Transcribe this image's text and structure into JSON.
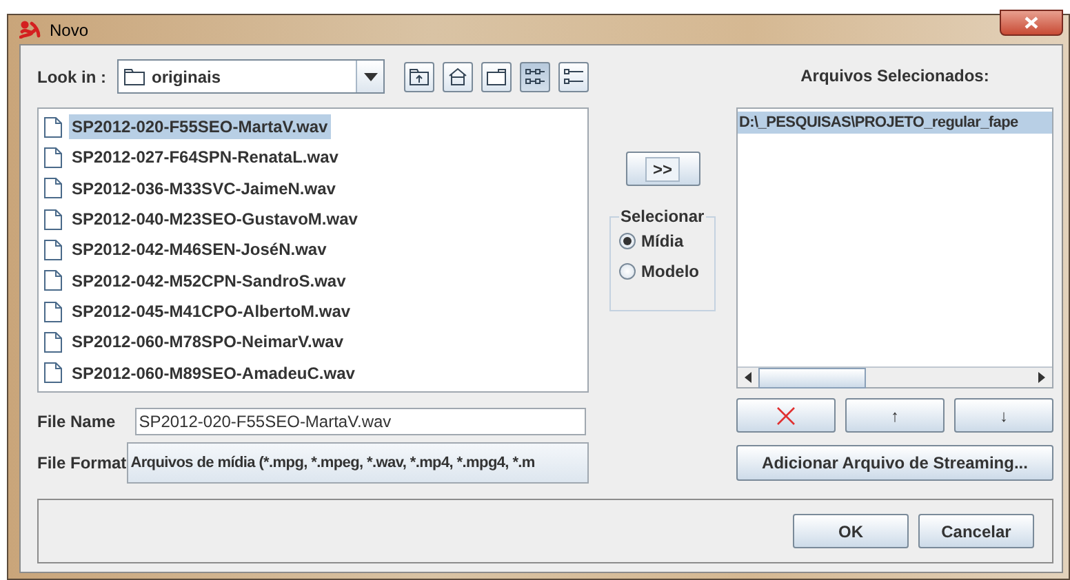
{
  "window": {
    "title": "Novo"
  },
  "look_in": {
    "label": "Look in :",
    "value": "originais"
  },
  "view_buttons": [
    {
      "kind": "list",
      "selected": true
    },
    {
      "kind": "details",
      "selected": false
    }
  ],
  "files": [
    {
      "name": "SP2012-020-F55SEO-MartaV.wav",
      "selected": true
    },
    {
      "name": "SP2012-027-F64SPN-RenataL.wav",
      "selected": false
    },
    {
      "name": "SP2012-036-M33SVC-JaimeN.wav",
      "selected": false
    },
    {
      "name": "SP2012-040-M23SEO-GustavoM.wav",
      "selected": false
    },
    {
      "name": "SP2012-042-M46SEN-JoséN.wav",
      "selected": false
    },
    {
      "name": "SP2012-042-M52CPN-SandroS.wav",
      "selected": false
    },
    {
      "name": "SP2012-045-M41CPO-AlbertoM.wav",
      "selected": false
    },
    {
      "name": "SP2012-060-M78SPO-NeimarV.wav",
      "selected": false
    },
    {
      "name": "SP2012-060-M89SEO-AmadeuC.wav",
      "selected": false
    }
  ],
  "file_name": {
    "label": "File Name",
    "value": "SP2012-020-F55SEO-MartaV.wav"
  },
  "file_format": {
    "label": "File Format",
    "value": "Arquivos de mídia (*.mpg, *.mpeg, *.wav, *.mp4, *.mpg4, *.m"
  },
  "add_button": ">>",
  "selection_group": {
    "title": "Selecionar",
    "options": [
      {
        "label": "Mídia",
        "selected": true
      },
      {
        "label": "Modelo",
        "selected": false
      }
    ]
  },
  "selected_files": {
    "title": "Arquivos Selecionados:",
    "items": [
      {
        "path": "D:\\_PESQUISAS\\PROJETO_regular_fape",
        "selected": true
      }
    ]
  },
  "list_buttons": [
    {
      "kind": "remove"
    },
    {
      "kind": "text",
      "label": "↑"
    },
    {
      "kind": "text",
      "label": "↓"
    }
  ],
  "streaming_button": "Adicionar Arquivo de Streaming...",
  "dialog_buttons": [
    "OK",
    "Cancelar"
  ]
}
